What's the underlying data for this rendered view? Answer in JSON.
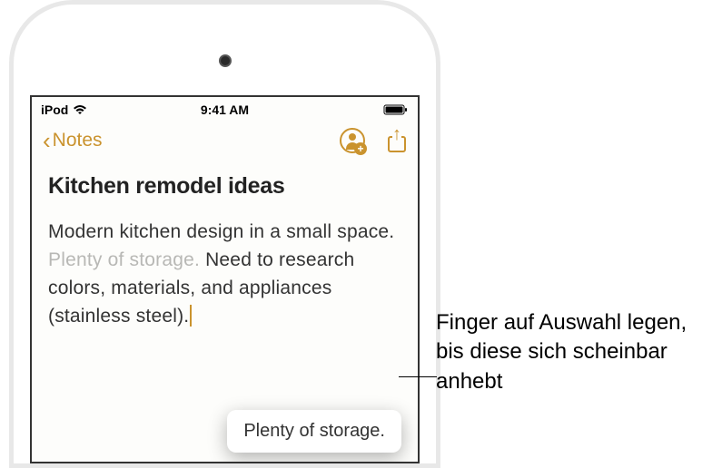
{
  "status_bar": {
    "device": "iPod",
    "time": "9:41 AM"
  },
  "nav": {
    "back_label": "Notes"
  },
  "note": {
    "title": "Kitchen remodel ideas",
    "body_part1": "Modern kitchen design in a small space. ",
    "body_highlighted": "Plenty of storage.",
    "body_part2": " Need to research colors, materials, and appliances (stainless steel)."
  },
  "drag_popup": {
    "text": "Plenty of storage."
  },
  "callout": {
    "text": "Finger auf Auswahl legen, bis diese sich scheinbar anhebt"
  }
}
